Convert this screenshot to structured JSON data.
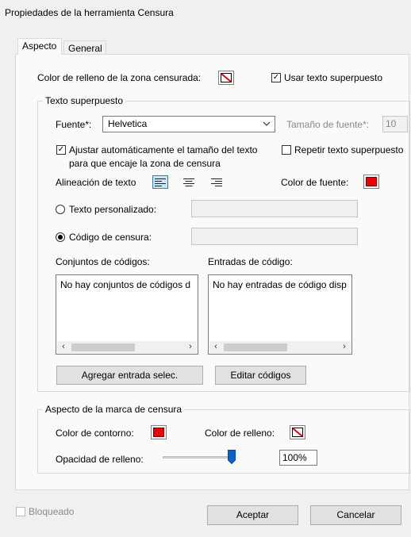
{
  "window": {
    "title": "Propiedades de la herramienta Censura"
  },
  "tabs": [
    {
      "label": "Aspecto",
      "active": true
    },
    {
      "label": "General",
      "active": false
    }
  ],
  "fill_color": {
    "label": "Color de relleno de la zona censurada:",
    "icon": "no-color-icon"
  },
  "overlay_toggle": {
    "label": "Usar texto superpuesto",
    "checked": true
  },
  "overlay_group": {
    "legend": "Texto superpuesto",
    "font_label": "Fuente*:",
    "font_value": "Helvetica",
    "font_size_label": "Tamaño de fuente*:",
    "font_size_value": "10",
    "autofit": {
      "label_line1": "Ajustar automáticamente el tamaño del texto",
      "label_line2": "para que encaje la zona de censura",
      "checked": true
    },
    "repeat": {
      "label": "Repetir texto superpuesto",
      "checked": false
    },
    "alignment_label": "Alineación de texto",
    "alignment_selected": "left",
    "font_color_label": "Color de fuente:",
    "font_color": "#e8000b",
    "custom_text": {
      "label": "Texto personalizado:",
      "selected": false,
      "value": ""
    },
    "redaction_code": {
      "label": "Código de censura:",
      "selected": true,
      "value": ""
    },
    "code_sets_label": "Conjuntos de códigos:",
    "code_sets_items": [
      "No hay conjuntos de códigos d"
    ],
    "code_entries_label": "Entradas de código:",
    "code_entries_items": [
      "No hay entradas de código disp"
    ],
    "add_entry_button": "Agregar entrada selec.",
    "edit_codes_button": "Editar códigos"
  },
  "mark_group": {
    "legend": "Aspecto de la marca de censura",
    "outline_color_label": "Color de contorno:",
    "outline_color": "#e8000b",
    "fill_color_label": "Color de relleno:",
    "fill_color_icon": "no-color-icon",
    "opacity_label": "Opacidad de relleno:",
    "opacity_value": "100%",
    "opacity_fraction": 1.0
  },
  "footer": {
    "locked_label": "Bloqueado",
    "locked_checked": false,
    "ok_button": "Aceptar",
    "cancel_button": "Cancelar"
  }
}
